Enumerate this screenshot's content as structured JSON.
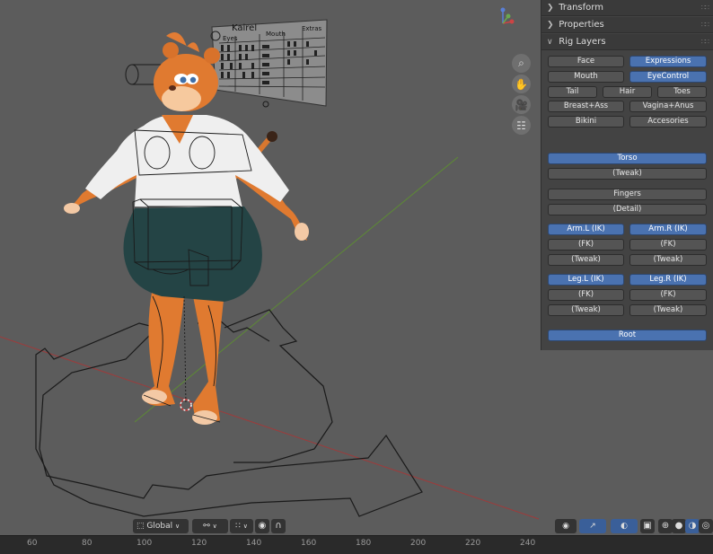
{
  "viewport": {
    "gizmo": {
      "x_label": "x",
      "y_label": "y",
      "z_label": "z"
    },
    "nav_icons": [
      "zoom-icon",
      "pan-hand-icon",
      "camera-icon",
      "grid-icon"
    ],
    "sheet": {
      "name": "Kairel",
      "col_eyes": "Eyes",
      "col_mouth": "Mouth",
      "col_extras": "Extras"
    }
  },
  "npanel": {
    "transform": "Transform",
    "properties": "Properties",
    "rig_layers": "Rig Layers",
    "buttons": {
      "face": "Face",
      "expressions": "Expressions",
      "mouth": "Mouth",
      "eyecontrol": "EyeControl",
      "tail": "Tail",
      "hair": "Hair",
      "toes": "Toes",
      "breast_ass": "Breast+Ass",
      "vagina_anus": "Vagina+Anus",
      "bikini": "Bikini",
      "accesories": "Accesories",
      "torso": "Torso",
      "torso_tweak": "(Tweak)",
      "fingers": "Fingers",
      "fingers_detail": "(Detail)",
      "arm_l_ik": "Arm.L (IK)",
      "arm_r_ik": "Arm.R (IK)",
      "arm_l_fk": "(FK)",
      "arm_r_fk": "(FK)",
      "arm_l_tweak": "(Tweak)",
      "arm_r_tweak": "(Tweak)",
      "leg_l_ik": "Leg.L (IK)",
      "leg_r_ik": "Leg.R (IK)",
      "leg_l_fk": "(FK)",
      "leg_r_fk": "(FK)",
      "leg_l_tweak": "(Tweak)",
      "leg_r_tweak": "(Tweak)",
      "root": "Root"
    }
  },
  "toolbar": {
    "orientation": "Global"
  },
  "timeline": {
    "ticks": [
      "60",
      "80",
      "100",
      "120",
      "140",
      "160",
      "180",
      "200",
      "220",
      "240"
    ]
  },
  "colors": {
    "accent_blue": "#4a72b0",
    "x_axis_red": "#a33a3a",
    "y_axis_green": "#5e8a3a",
    "fur_orange": "#e07a30"
  }
}
